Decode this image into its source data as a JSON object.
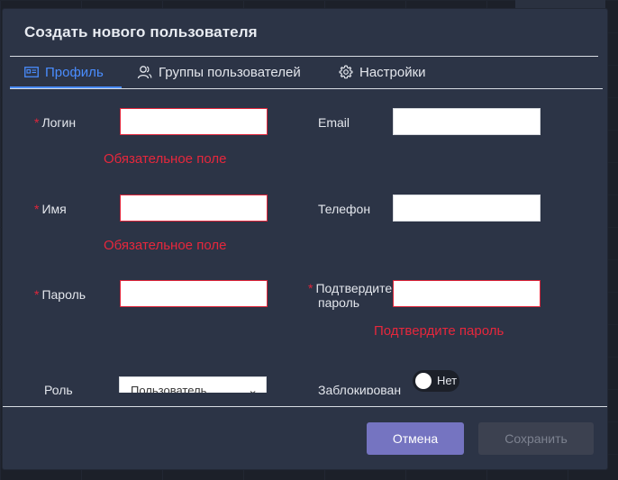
{
  "dialog": {
    "title": "Создать нового пользователя"
  },
  "tabs": [
    {
      "label": "Профиль",
      "icon": "id-card-icon",
      "active": true
    },
    {
      "label": "Группы пользователей",
      "icon": "users-icon",
      "active": false
    },
    {
      "label": "Настройки",
      "icon": "gear-icon",
      "active": false
    }
  ],
  "form": {
    "login": {
      "label": "Логин",
      "required": true,
      "value": "",
      "error": "Обязательное поле"
    },
    "email": {
      "label": "Email",
      "required": false,
      "value": ""
    },
    "name": {
      "label": "Имя",
      "required": true,
      "value": "",
      "error": "Обязательное поле"
    },
    "phone": {
      "label": "Телефон",
      "required": false,
      "value": ""
    },
    "password": {
      "label": "Пароль",
      "required": true,
      "value": ""
    },
    "confirm_password": {
      "label_line1": "Подтвердите",
      "label_line2": "пароль",
      "required": true,
      "value": "",
      "error": "Подтвердите пароль"
    },
    "role": {
      "label": "Роль",
      "selected": "Пользователь"
    },
    "blocked": {
      "label": "Заблокирован",
      "toggle_text": "Нет",
      "on": false
    }
  },
  "footer": {
    "cancel_label": "Отмена",
    "save_label": "Сохранить"
  },
  "colors": {
    "accent": "#4a8dff",
    "error": "#e0253a",
    "cancel_button": "#7574c1",
    "dialog_bg": "#2c3446"
  }
}
